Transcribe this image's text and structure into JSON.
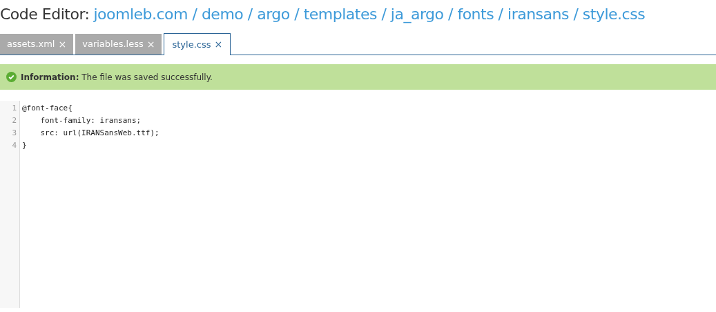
{
  "header": {
    "label": "Code Editor:",
    "path": "joomleb.com / demo / argo / templates / ja_argo / fonts / iransans / style.css"
  },
  "tabs": [
    {
      "label": "assets.xml",
      "close": "×",
      "selected": false
    },
    {
      "label": "variables.less",
      "close": "×",
      "selected": false
    },
    {
      "label": "style.css",
      "close": "×",
      "selected": true
    }
  ],
  "alert": {
    "title": "Information:",
    "message": "The file was saved successfully."
  },
  "editor": {
    "lines": [
      {
        "number": "1",
        "code": "@font-face{"
      },
      {
        "number": "2",
        "code": "    font-family: iransans;"
      },
      {
        "number": "3",
        "code": "    src: url(IRANSansWeb.ttf);"
      },
      {
        "number": "4",
        "code": "}"
      }
    ]
  }
}
